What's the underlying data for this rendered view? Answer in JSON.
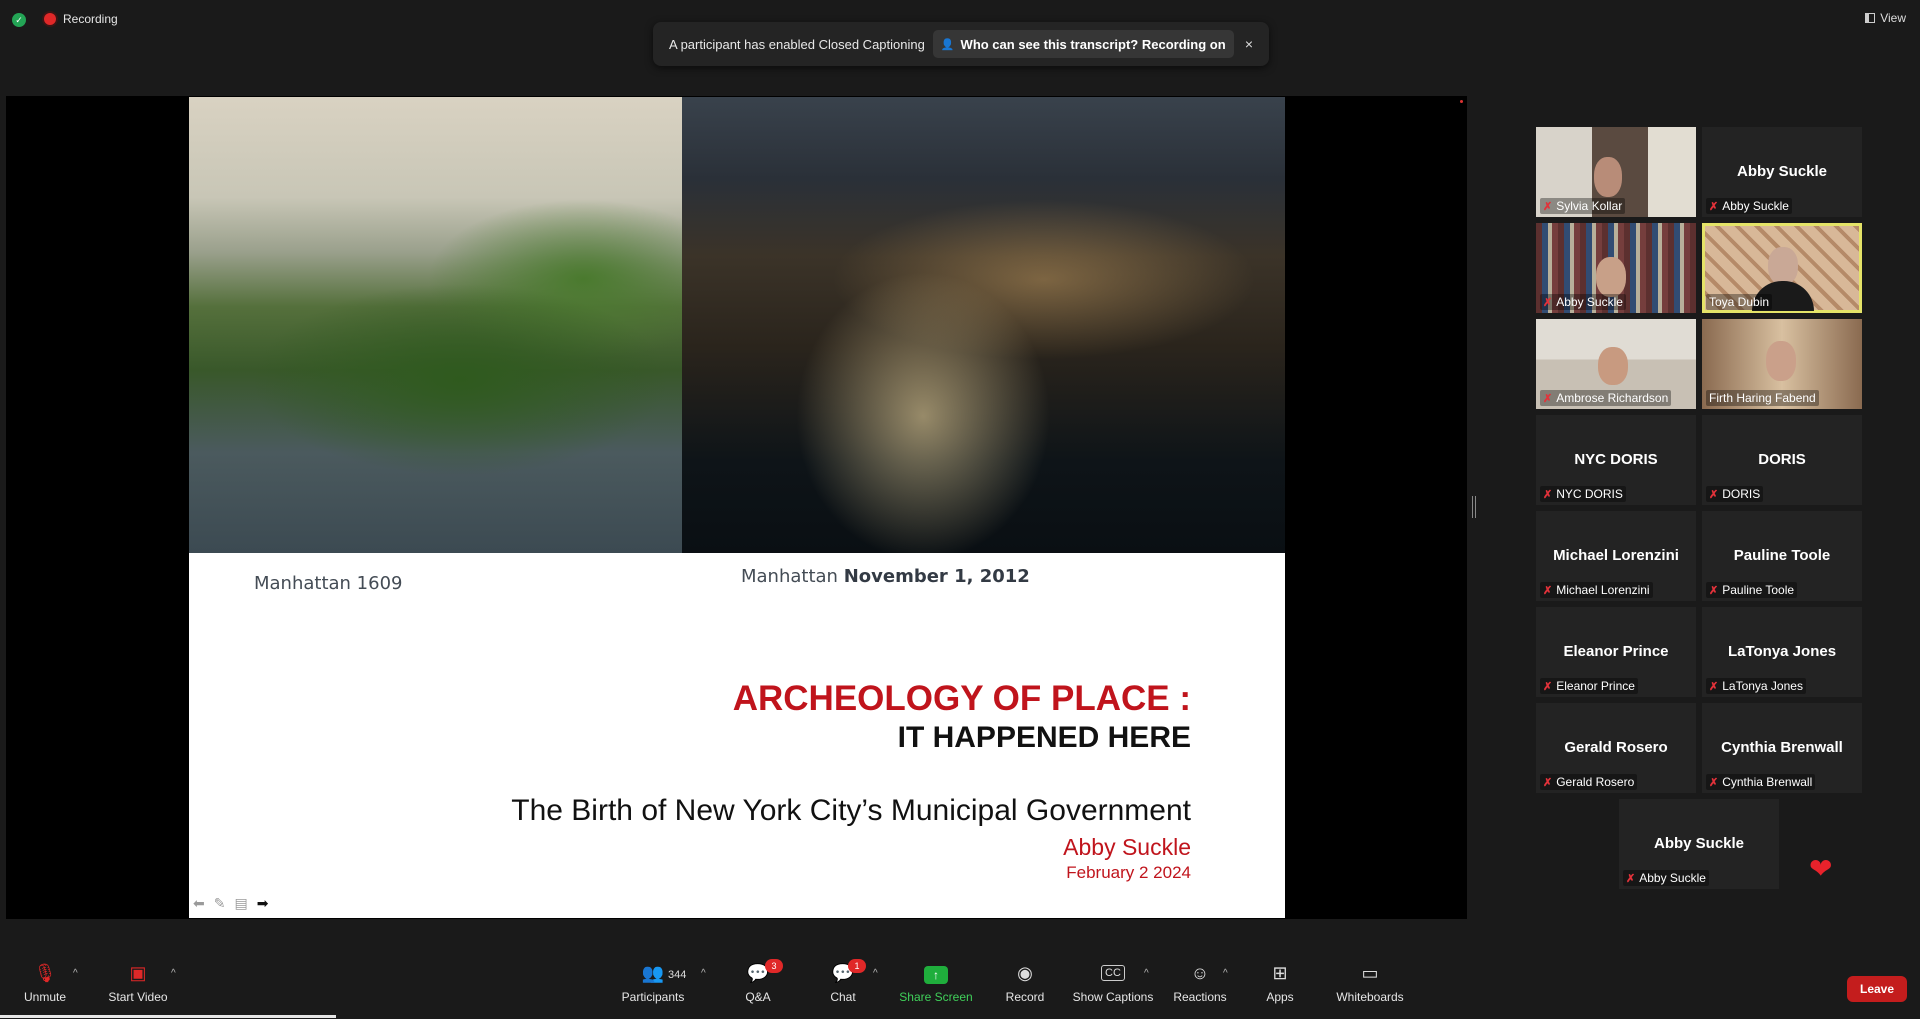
{
  "topbar": {
    "recording_label": "Recording",
    "view_label": "View",
    "cc_message": "A participant has enabled Closed Captioning",
    "cc_who": "Who can see this transcript? Recording on",
    "cc_close": "×"
  },
  "slide": {
    "caption_left": "Manhattan 1609",
    "caption_right_prefix": "Manhattan",
    "caption_right_bold": "November 1, 2012",
    "title_line1": "ARCHEOLOGY OF PLACE :",
    "title_line2": "IT HAPPENED HERE",
    "subtitle": "The Birth of New York City’s Municipal Government",
    "author": "Abby Suckle",
    "date": "February 2 2024",
    "accent_color": "#c0141c"
  },
  "gallery": {
    "tiles": [
      {
        "name": "Sylvia Kollar",
        "video": true
      },
      {
        "display": "Abby Suckle",
        "name": "Abby Suckle",
        "video": false
      },
      {
        "name": "Abby Suckle",
        "video": true
      },
      {
        "name": "Toya Dubin",
        "video": true,
        "active": true
      },
      {
        "name": "Ambrose Richardson",
        "video": true
      },
      {
        "name": "Firth Haring Fabend",
        "video": true
      },
      {
        "display": "NYC DORIS",
        "name": "NYC DORIS",
        "video": false
      },
      {
        "display": "DORIS",
        "name": "DORIS",
        "video": false
      },
      {
        "display": "Michael Lorenzini",
        "name": "Michael Lorenzini",
        "video": false
      },
      {
        "display": "Pauline Toole",
        "name": "Pauline Toole",
        "video": false
      },
      {
        "display": "Eleanor Prince",
        "name": "Eleanor Prince",
        "video": false
      },
      {
        "display": "LaTonya Jones",
        "name": "LaTonya Jones",
        "video": false
      },
      {
        "display": "Gerald Rosero",
        "name": "Gerald Rosero",
        "video": false
      },
      {
        "display": "Cynthia Brenwall",
        "name": "Cynthia Brenwall",
        "video": false
      },
      {
        "display": "Abby Suckle",
        "name": "Abby Suckle",
        "video": false
      }
    ],
    "active_border_color": "#e4e368"
  },
  "toolbar": {
    "unmute": "Unmute",
    "start_video": "Start Video",
    "participants": "Participants",
    "participants_count": "344",
    "qa": "Q&A",
    "qa_badge": "3",
    "chat": "Chat",
    "chat_badge": "1",
    "share_screen": "Share Screen",
    "record": "Record",
    "show_captions": "Show Captions",
    "reactions": "Reactions",
    "apps": "Apps",
    "whiteboards": "Whiteboards",
    "leave": "Leave",
    "share_color": "#1fae3c",
    "leave_color": "#c41d1d"
  }
}
